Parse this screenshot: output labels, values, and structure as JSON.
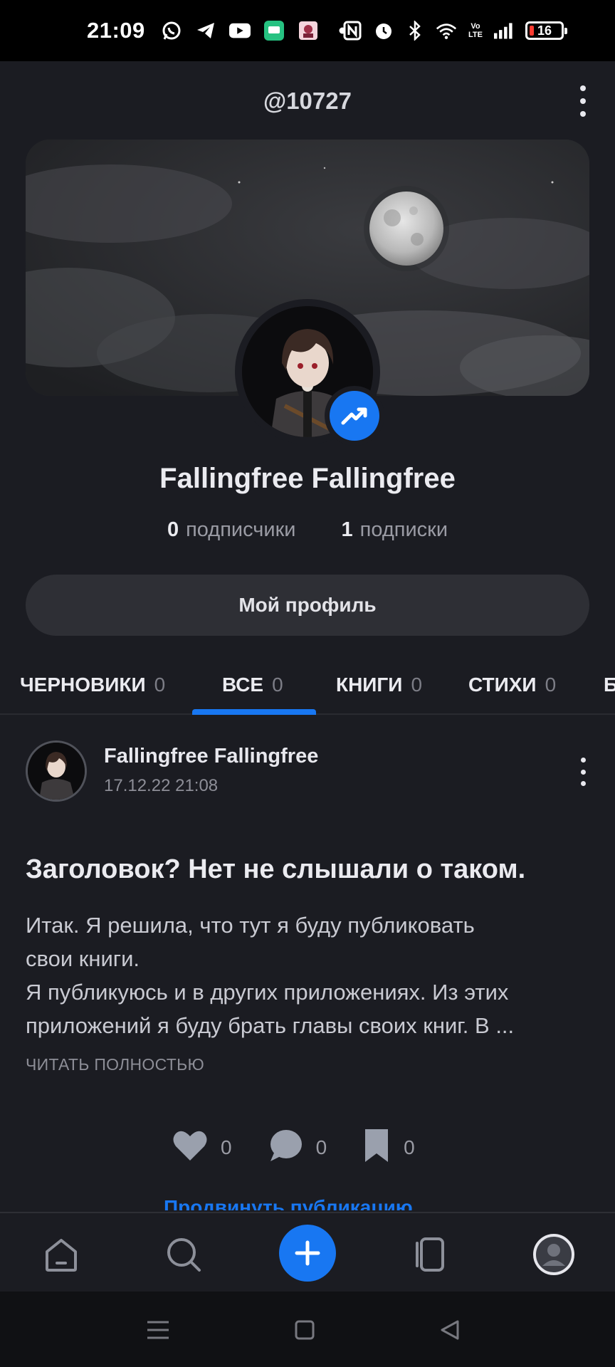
{
  "status_bar": {
    "time": "21:09",
    "network": "Vo LTE",
    "battery_level": "16",
    "left_icons": [
      "whatsapp-icon",
      "telegram-icon",
      "youtube-icon",
      "chat-app-icon",
      "photo-app-icon",
      "dot-icon"
    ],
    "right_icons": [
      "nfc-icon",
      "alarm-icon",
      "bluetooth-icon",
      "wifi-icon",
      "volte-icon",
      "signal-icon",
      "battery-icon"
    ]
  },
  "header": {
    "handle": "@10727"
  },
  "profile": {
    "name": "Fallingfree Fallingfree",
    "followers_count": "0",
    "followers_label": "подписчики",
    "following_count": "1",
    "following_label": "подписки",
    "profile_button": "Мой профиль"
  },
  "tabs": [
    {
      "label": "ЧЕРНОВИКИ",
      "count": "0"
    },
    {
      "label": "ВСЕ",
      "count": "0",
      "active": true
    },
    {
      "label": "КНИГИ",
      "count": "0"
    },
    {
      "label": "СТИХИ",
      "count": "0"
    },
    {
      "label": "Б",
      "count": ""
    }
  ],
  "post": {
    "author": "Fallingfree Fallingfree",
    "date": "17.12.22 21:08",
    "title": "Заголовок? Нет не слышали о таком.",
    "body_line1": "Итак. Я решила, что тут я буду публиковать",
    "body_line2": "свои книги.",
    "body_line3": "Я публикуюсь и в других приложениях. Из этих",
    "body_line4": "приложений я буду брать главы своих книг. В ...",
    "read_more": "ЧИТАТЬ ПОЛНОСТЬЮ",
    "likes": "0",
    "comments": "0",
    "bookmarks": "0",
    "promote": "Продвинуть публикацию"
  },
  "bottom_nav": {
    "items": [
      "home-icon",
      "search-icon",
      "add-icon",
      "feed-icon",
      "profile-icon"
    ]
  },
  "colors": {
    "accent": "#1877f2",
    "background": "#1b1c22",
    "surface": "#2e2f35"
  }
}
